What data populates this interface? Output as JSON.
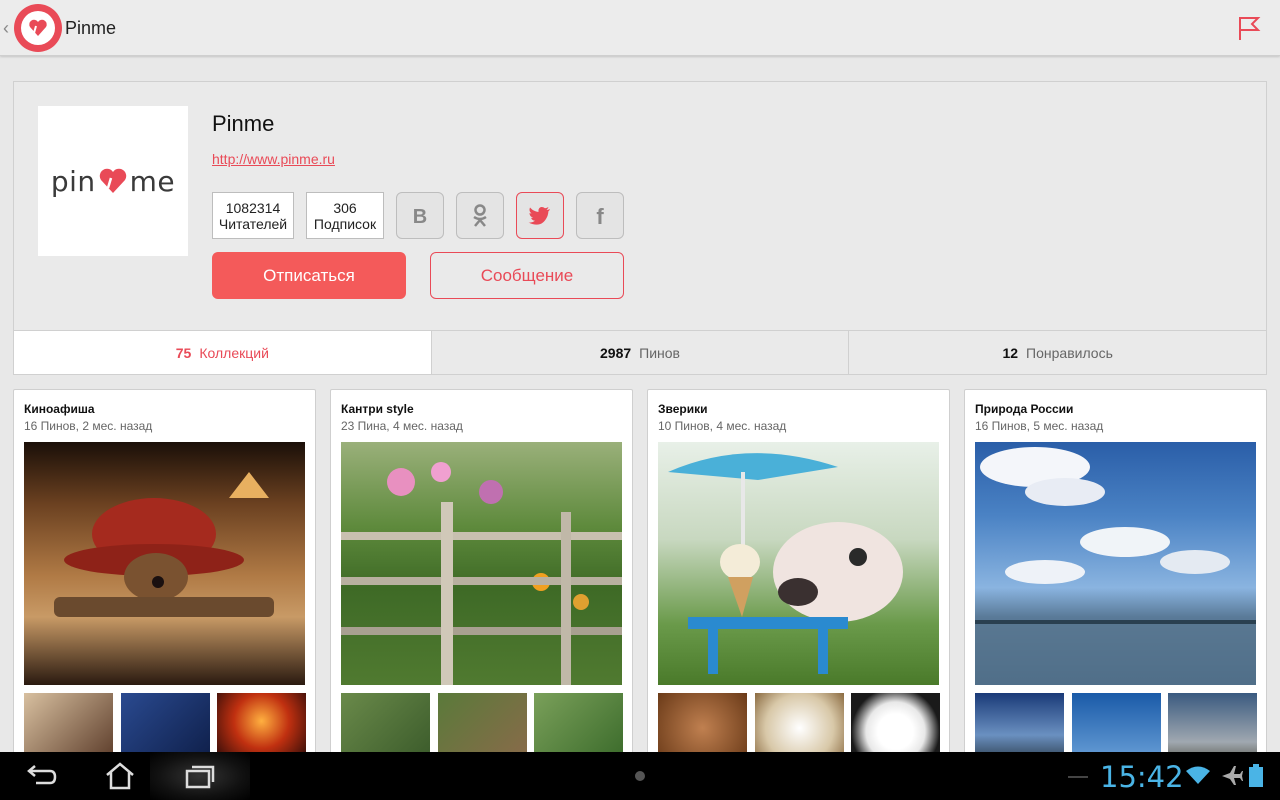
{
  "app": {
    "title": "Pinme"
  },
  "profile": {
    "name": "Pinme",
    "url": "http://www.pinme.ru",
    "avatar_text_left": "pin",
    "avatar_text_right": "me",
    "stats": [
      {
        "value": "1082314",
        "label": "Читателей"
      },
      {
        "value": "306",
        "label": "Подписок"
      }
    ],
    "social": [
      "vk-icon",
      "odnoklassniki-icon",
      "twitter-icon",
      "facebook-icon"
    ],
    "unsubscribe_label": "Отписаться",
    "message_label": "Сообщение"
  },
  "tabs": [
    {
      "num": "75",
      "label": "Коллекций",
      "active": true
    },
    {
      "num": "2987",
      "label": "Пинов",
      "active": false
    },
    {
      "num": "12",
      "label": "Понравилось",
      "active": false
    }
  ],
  "collections": [
    {
      "title": "Киноафиша",
      "meta": "16 Пинов, 2 мес. назад"
    },
    {
      "title": "Кантри style",
      "meta": "23 Пина, 4 мес. назад"
    },
    {
      "title": "Зверики",
      "meta": "10 Пинов, 4 мес. назад"
    },
    {
      "title": "Природа России",
      "meta": "16 Пинов, 5 мес. назад"
    }
  ],
  "status": {
    "time": "15:42"
  },
  "colors": {
    "accent": "#e94a57",
    "clock": "#4ab4e6"
  }
}
